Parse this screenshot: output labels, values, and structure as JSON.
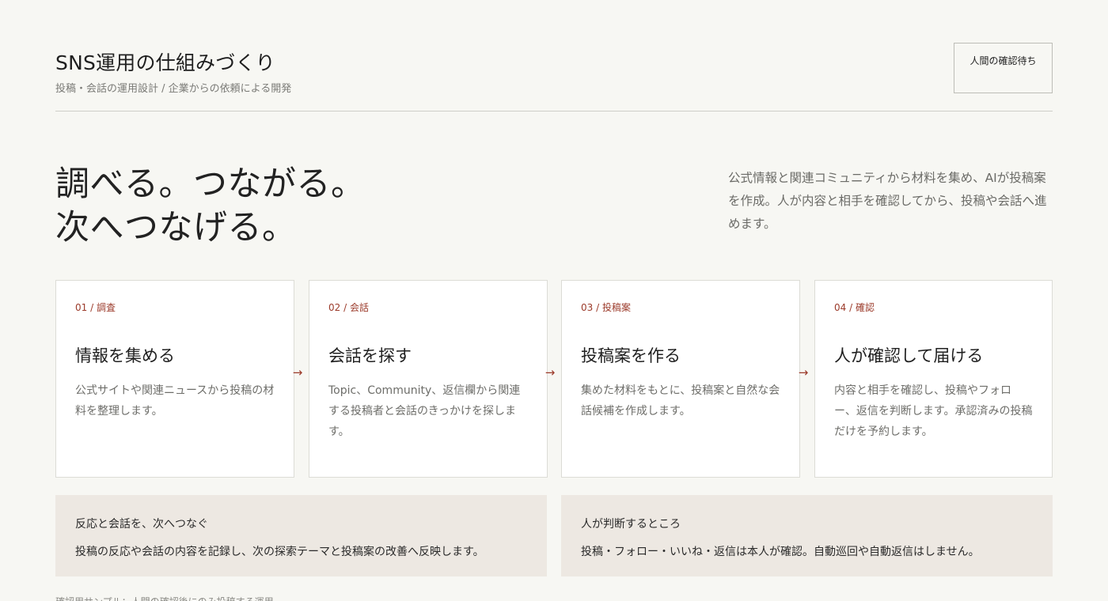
{
  "header": {
    "title": "SNS運用の仕組みづくり",
    "subtitle": "投稿・会話の運用設計 / 企業からの依頼による開発",
    "status_badge": "人間の確認待ち"
  },
  "hero": {
    "heading_line1": "調べる。つながる。",
    "heading_line2": "次へつなげる。",
    "description": "公式情報と関連コミュニティから材料を集め、AIが投稿案を作成。人が内容と相手を確認してから、投稿や会話へ進めます。"
  },
  "steps": [
    {
      "label": "01 / 調査",
      "title": "情報を集める",
      "desc": "公式サイトや関連ニュースから投稿の材料を整理します。"
    },
    {
      "label": "02 / 会話",
      "title": "会話を探す",
      "desc": "Topic、Community、返信欄から関連する投稿者と会話のきっかけを探します。"
    },
    {
      "label": "03 / 投稿案",
      "title": "投稿案を作る",
      "desc": "集めた材料をもとに、投稿案と自然な会話候補を作成します。"
    },
    {
      "label": "04 / 確認",
      "title": "人が確認して届ける",
      "desc": "内容と相手を確認し、投稿やフォロー、返信を判断します。承認済みの投稿だけを予約します。"
    }
  ],
  "arrow_glyph": "→",
  "info_panels": [
    {
      "title": "反応と会話を、次へつなぐ",
      "text": "投稿の反応や会話の内容を記録し、次の探索テーマと投稿案の改善へ反映します。"
    },
    {
      "title": "人が判断するところ",
      "text": "投稿・フォロー・いいね・返信は本人が確認。自動巡回や自動返信はしません。"
    }
  ],
  "footnote": "確認用サンプル：人間の確認後にのみ投稿する運用",
  "colors": {
    "accent": "#9b3a2a",
    "background": "#f7f7f3",
    "panel": "#ede8e2"
  }
}
